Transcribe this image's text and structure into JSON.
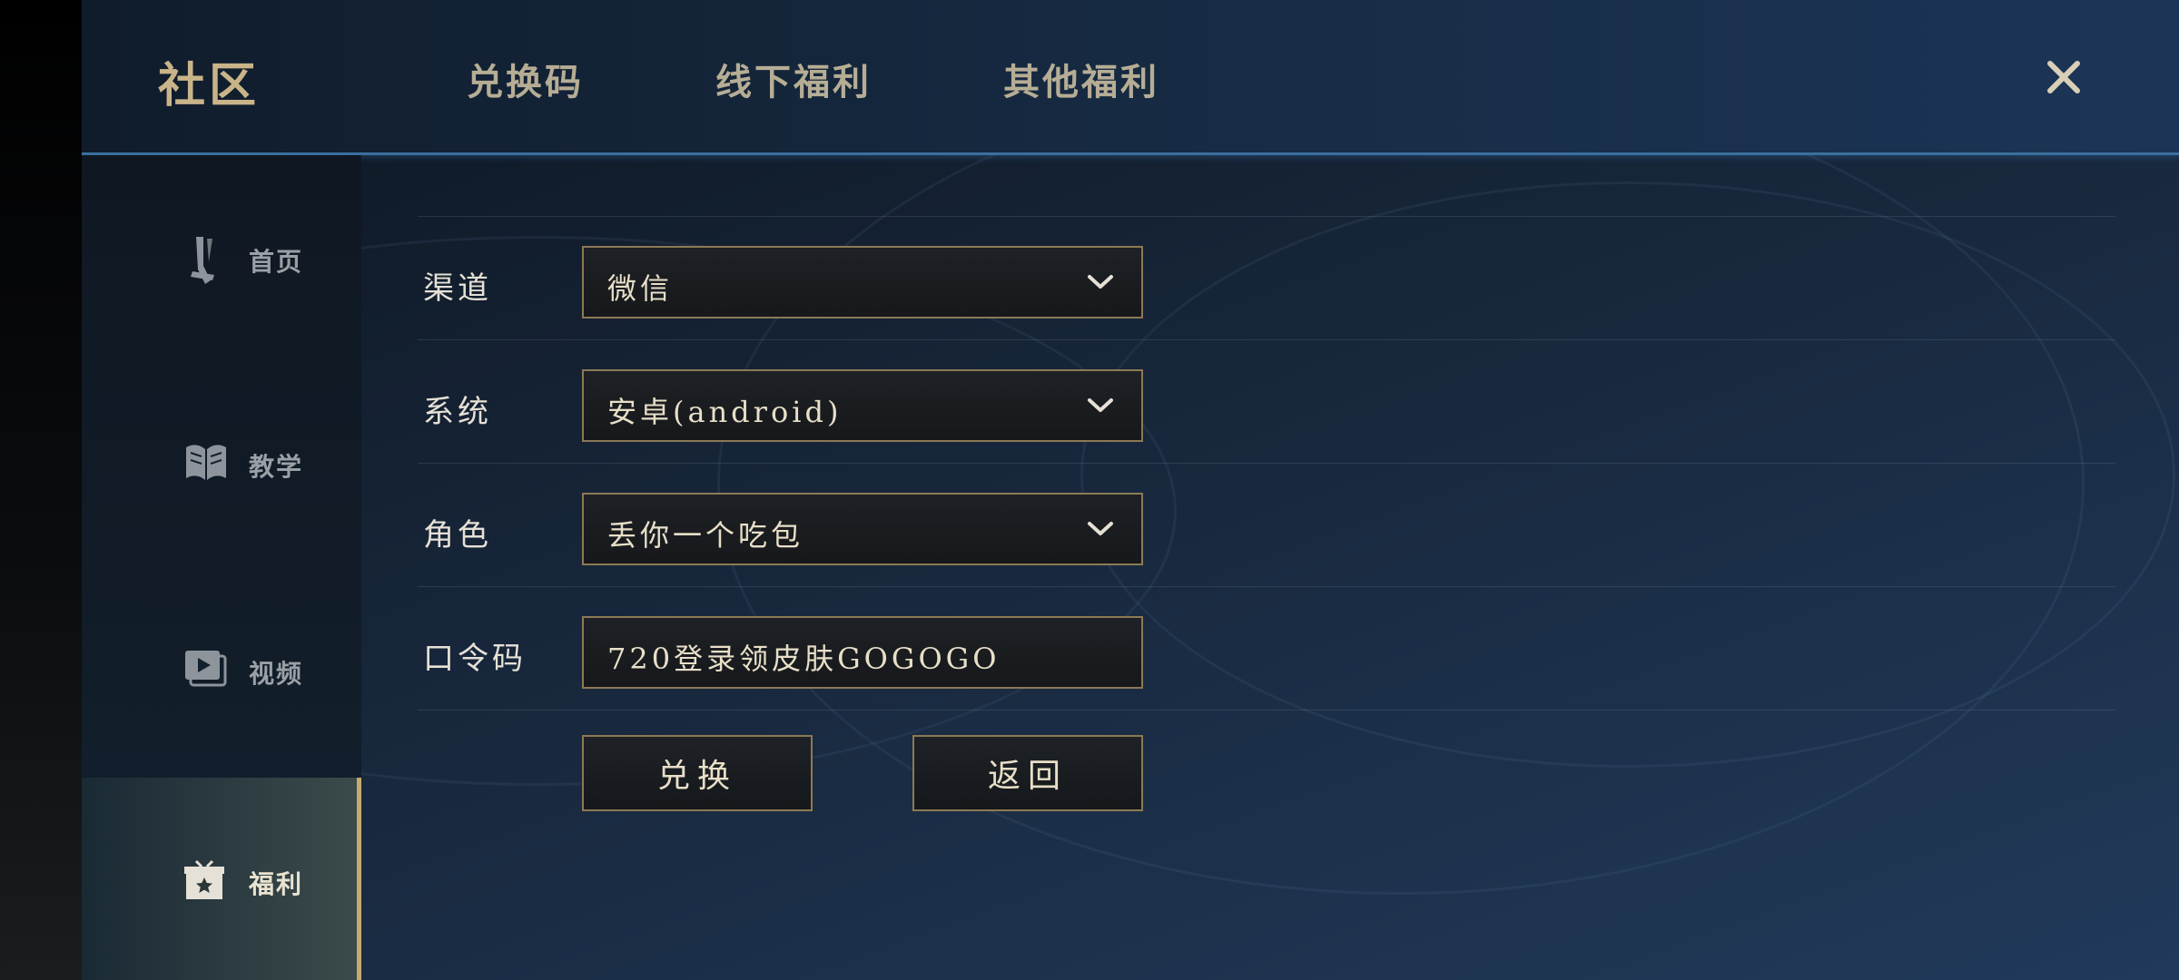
{
  "header": {
    "title": "社区",
    "tabs": [
      {
        "label": "兑换码"
      },
      {
        "label": "线下福利"
      },
      {
        "label": "其他福利"
      }
    ],
    "close_icon": "close-icon"
  },
  "sidebar": {
    "items": [
      {
        "label": "首页",
        "icon": "sword-icon"
      },
      {
        "label": "教学",
        "icon": "book-icon"
      },
      {
        "label": "视频",
        "icon": "video-icon"
      },
      {
        "label": "福利",
        "icon": "gift-icon",
        "active": true
      }
    ]
  },
  "form": {
    "channel": {
      "label": "渠道",
      "value": "微信"
    },
    "system": {
      "label": "系统",
      "value": "安卓(android)"
    },
    "role": {
      "label": "角色",
      "value": "丢你一个吃包"
    },
    "code": {
      "label": "口令码",
      "value": "720登录领皮肤GOGOGO"
    },
    "redeem_label": "兑换",
    "back_label": "返回"
  },
  "colors": {
    "accent_gold": "#c8aa6e",
    "header_blue_line": "#3b6f9e"
  }
}
